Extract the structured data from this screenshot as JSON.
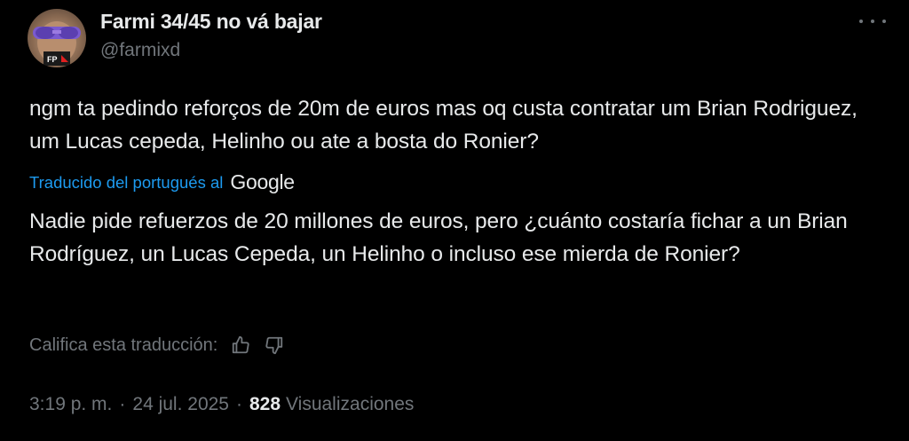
{
  "author": {
    "display_name": "Farmi 34/45 no vá bajar",
    "handle": "@farmixd",
    "avatar_icon": "avatar-photo"
  },
  "tweet": {
    "text": "ngm ta pedindo reforços de 20m de euros mas oq custa contratar um Brian Rodriguez, um Lucas cepeda, Helinho ou ate a bosta do Ronier?"
  },
  "translation": {
    "label": "Traducido del portugués al",
    "provider": "Google",
    "text": "Nadie pide refuerzos de 20 millones de euros, pero ¿cuánto costaría fichar a un Brian Rodríguez, un Lucas Cepeda, un Helinho o incluso ese mierda de Ronier?",
    "rate_label": "Califica esta traducción:",
    "thumbs_up_icon": "thumbs-up-icon",
    "thumbs_down_icon": "thumbs-down-icon"
  },
  "meta": {
    "time": "3:19 p. m.",
    "separator": "·",
    "date": "24 jul. 2025",
    "views_count": "828",
    "views_label": "Visualizaciones"
  },
  "colors": {
    "background": "#000000",
    "text_primary": "#e7e9ea",
    "text_secondary": "#71767b",
    "link": "#1d9bf0"
  }
}
